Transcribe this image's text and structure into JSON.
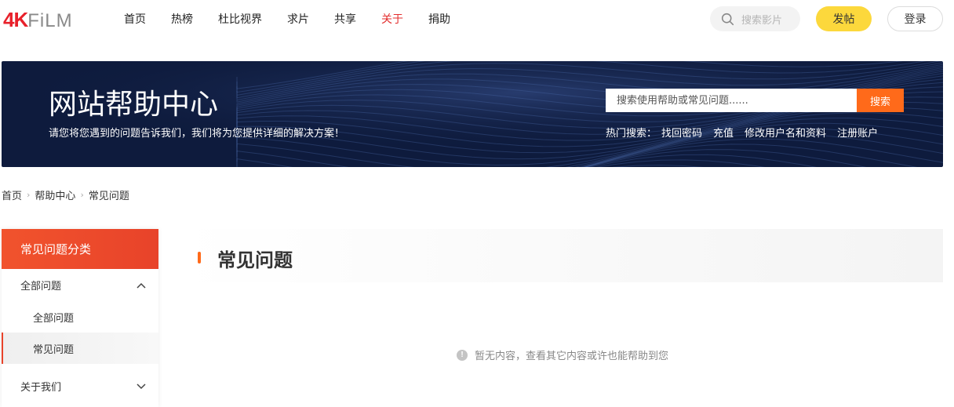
{
  "logo": {
    "part1": "4K",
    "part2": "FiLM"
  },
  "nav": [
    {
      "label": "首页"
    },
    {
      "label": "热榜"
    },
    {
      "label": "杜比视界"
    },
    {
      "label": "求片"
    },
    {
      "label": "共享"
    },
    {
      "label": "关于",
      "active": true
    },
    {
      "label": "捐助"
    }
  ],
  "header": {
    "search_placeholder": "搜索影片",
    "post_label": "发帖",
    "login_label": "登录"
  },
  "banner": {
    "title": "网站帮助中心",
    "subtitle": "请您将您遇到的问题告诉我们，我们将为您提供详细的解决方案！",
    "search_placeholder": "搜索使用帮助或常见问题......",
    "search_button": "搜索",
    "hot_label": "热门搜索：",
    "hot_links": [
      "找回密码",
      "充值",
      "修改用户名和资料",
      "注册账户"
    ]
  },
  "breadcrumb": [
    "首页",
    "帮助中心",
    "常见问题"
  ],
  "sidebar": {
    "header": "常见问题分类",
    "group1": "全部问题",
    "sub1": "全部问题",
    "sub2": "常见问题",
    "group2": "关于我们"
  },
  "main": {
    "title": "常见问题",
    "empty_text": "暂无内容，查看其它内容或许也能帮助到您"
  },
  "colors": {
    "accent_orange": "#ff6a1a",
    "accent_red": "#e8432a",
    "post_yellow": "#fcd83c",
    "banner_navy": "#0e1b3d"
  }
}
